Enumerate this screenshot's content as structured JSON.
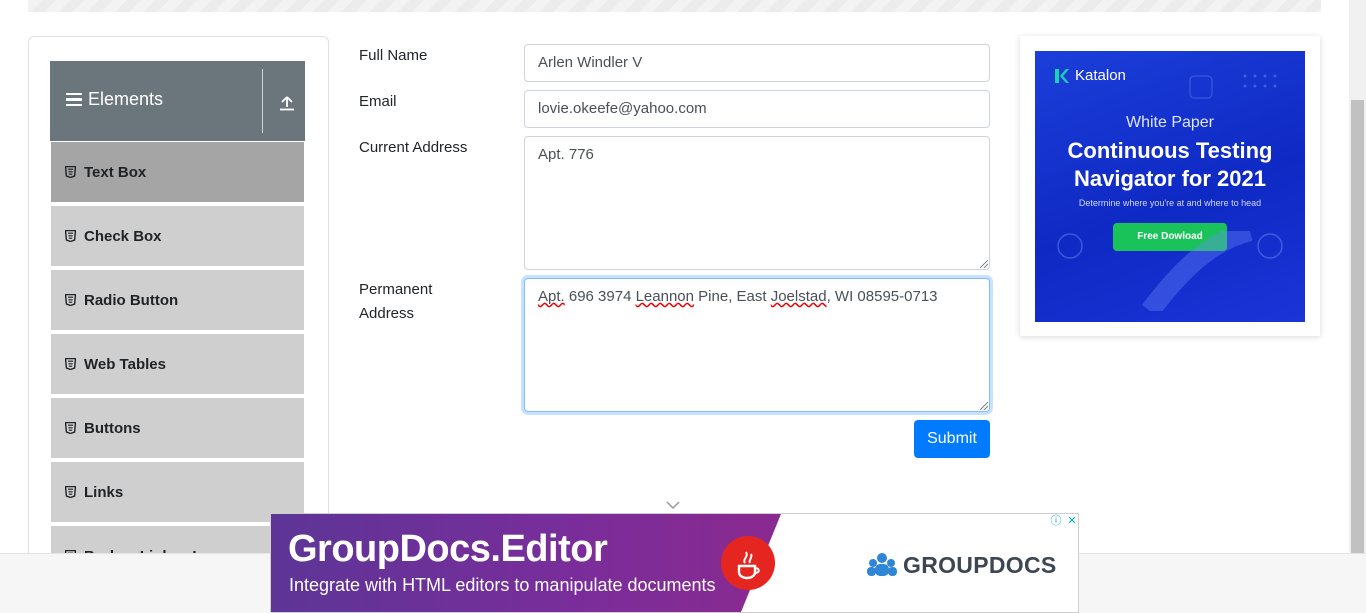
{
  "sidebar": {
    "group_title": "Elements",
    "items": [
      {
        "label": "Text Box"
      },
      {
        "label": "Check Box"
      },
      {
        "label": "Radio Button"
      },
      {
        "label": "Web Tables"
      },
      {
        "label": "Buttons"
      },
      {
        "label": "Links"
      },
      {
        "label": "Broken Links - Images"
      }
    ]
  },
  "form": {
    "full_name_label": "Full Name",
    "full_name_value": "Arlen Windler V",
    "email_label": "Email",
    "email_value": "lovie.okeefe@yahoo.com",
    "current_address_label": "Current Address",
    "current_address_value": "Apt. 776",
    "permanent_address_label_1": "Permanent",
    "permanent_address_label_2": "Address",
    "permanent_address_parts": [
      "Apt.",
      " 696 3974 ",
      "Leannon",
      " Pine, East ",
      "Joelstad",
      ", WI 08595-0713"
    ],
    "submit_label": "Submit"
  },
  "ad_right": {
    "brand": "Katalon",
    "kicker": "White Paper",
    "headline_1": "Continuous Testing",
    "headline_2": "Navigator for 2021",
    "subtext": "Determine where you're at and where to head",
    "cta": "Free Dowload"
  },
  "ad_bottom": {
    "title": "GroupDocs.Editor",
    "tagline": "Integrate with HTML editors to manipulate documents",
    "logo_text": "GROUPDOCS"
  },
  "colors": {
    "primary": "#007bff",
    "sidebar_header": "#6b757c",
    "menu_item": "#cfcfcf",
    "menu_item_active": "#a5a5a5"
  },
  "icons": [
    "hamburger-icon",
    "upload-icon",
    "html5-icon",
    "chevron-down-icon",
    "katalon-logo-icon",
    "java-icon",
    "groupdocs-logo-icon",
    "adchoices-icon",
    "close-icon"
  ]
}
